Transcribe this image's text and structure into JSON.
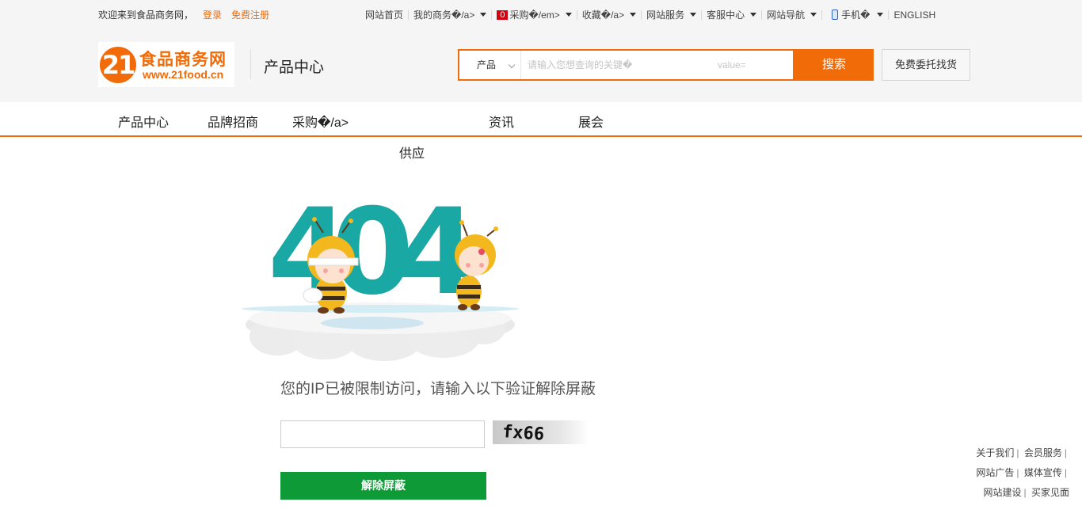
{
  "topbar": {
    "welcome": "欢迎来到食品商务网，",
    "login": "登录",
    "register": "免费注册",
    "items": [
      {
        "label": "网站首页",
        "has_caret": false
      },
      {
        "label": "我的商务�/a>",
        "has_caret": true
      },
      {
        "label": "采购�/em>",
        "badge": "0",
        "has_caret": true
      },
      {
        "label": "收藏�/a>",
        "has_caret": true
      },
      {
        "label": "网站服务",
        "has_caret": true
      },
      {
        "label": "客服中心",
        "has_caret": true
      },
      {
        "label": "网站导航",
        "has_caret": true
      },
      {
        "label": "手机�",
        "has_caret": true,
        "icon": "phone-icon"
      },
      {
        "label": "ENGLISH",
        "has_caret": false
      }
    ]
  },
  "logo": {
    "mark": "21",
    "name": "食品商务网",
    "url_text": "www.21food.cn"
  },
  "channel": "产品中心",
  "search": {
    "category": "产品",
    "placeholder": "请输入您想查询的关键�",
    "extra": "value=",
    "button": "搜索"
  },
  "entrust_button": "免费委托找货",
  "main_nav": [
    "产品中心",
    "品牌招商",
    "采购�/a>",
    "资讯",
    "展会"
  ],
  "supply": "供应",
  "error": {
    "code_digits": [
      "4",
      "0",
      "4"
    ],
    "message": "您的IP已被限制访问，请输入以下验证解除屏蔽",
    "captcha_text": "fx66",
    "unblock_button": "解除屏蔽"
  },
  "footer_links": [
    "关于我们",
    "会员服务",
    "网站广告",
    "媒体宣传",
    "网站建设",
    "买家见面"
  ],
  "colors": {
    "accent": "#f16b09",
    "teal": "#1aa8a4",
    "green": "#0e9a36",
    "badge": "#d7000f"
  }
}
